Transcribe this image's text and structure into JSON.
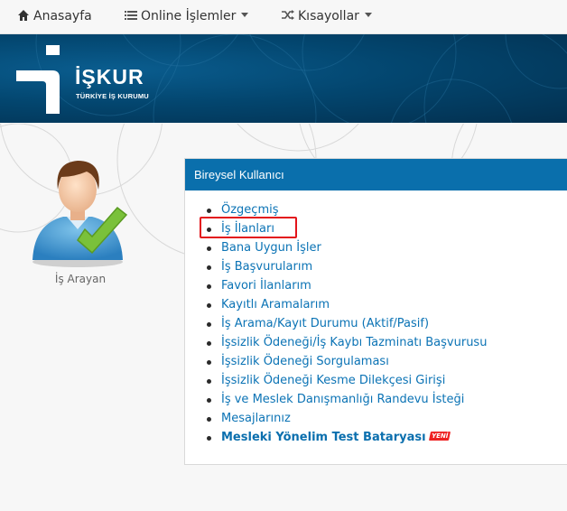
{
  "nav": {
    "home": "Anasayfa",
    "online": "Online İşlemler",
    "shortcuts": "Kısayollar"
  },
  "header": {
    "brand": "İŞKUR",
    "subtitle": "TÜRKİYE İŞ KURUMU"
  },
  "user": {
    "label": "İş Arayan"
  },
  "panel": {
    "title": "Bireysel Kullanıcı",
    "items": [
      "Özgeçmiş",
      "İş İlanları",
      "Bana Uygun İşler",
      "İş Başvurularım",
      "Favori İlanlarım",
      "Kayıtlı Aramalarım",
      "İş Arama/Kayıt Durumu (Aktif/Pasif)",
      "İşsizlik Ödeneği/İş Kaybı Tazminatı Başvurusu",
      "İşsizlik Ödeneği Sorgulaması",
      "İşsizlik Ödeneği Kesme Dilekçesi Girişi",
      "İş ve Meslek Danışmanlığı Randevu İsteği",
      "Mesajlarınız",
      "Mesleki Yönelim Test Bataryası"
    ],
    "new_badge": "YENİ"
  },
  "colors": {
    "header_bg": "#03466f",
    "panel_head": "#0a6fac",
    "link": "#0b73b5",
    "highlight": "#e3141b"
  },
  "icons": {
    "home": "home-icon",
    "online": "list-icon",
    "shortcuts": "shuffle-icon",
    "user": "user-avatar-check-icon"
  }
}
